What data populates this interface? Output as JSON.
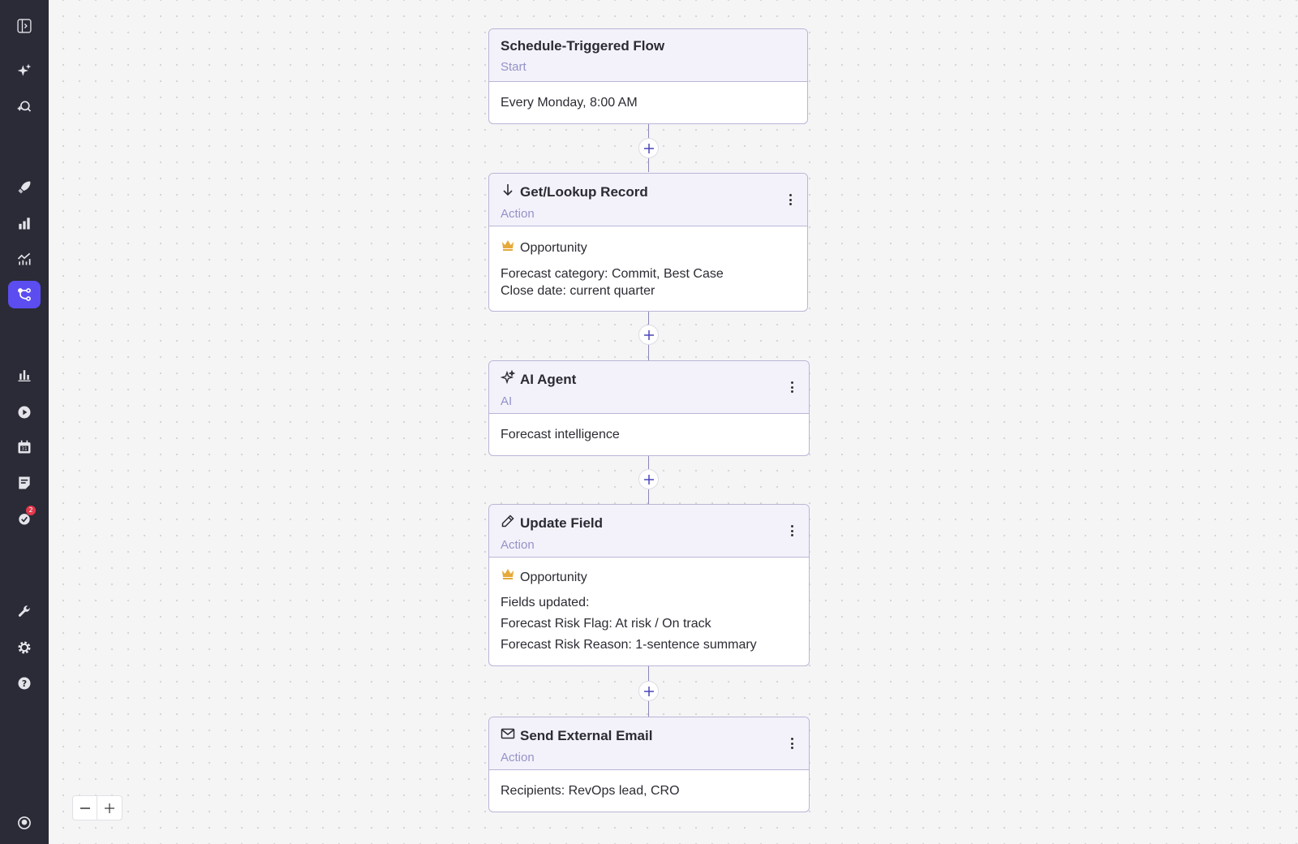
{
  "sidebar": {
    "icons": [
      "sidebar-toggle-icon",
      "sparkle-icon",
      "search-user-icon",
      "rocket-icon",
      "building-chart-icon",
      "line-chart-icon",
      "workflow-icon",
      "bar-chart-icon",
      "play-circle-icon",
      "calendar-icon",
      "note-icon",
      "check-circle-icon",
      "wrench-icon",
      "gear-icon",
      "help-icon",
      "profile-icon"
    ],
    "active": "workflow-icon",
    "notification_count": "2"
  },
  "flow": {
    "start": {
      "title": "Schedule-Triggered Flow",
      "subtitle": "Start",
      "body": "Every Monday, 8:00 AM"
    },
    "lookup": {
      "icon": "arrow-down-icon",
      "title": "Get/Lookup Record",
      "subtitle": "Action",
      "object": "Opportunity",
      "line1": "Forecast category: Commit, Best Case",
      "line2": "Close date: current quarter"
    },
    "agent": {
      "icon": "sparkle-icon",
      "title": "AI Agent",
      "subtitle": "AI",
      "body": "Forecast intelligence"
    },
    "update": {
      "icon": "pencil-icon",
      "title": "Update Field",
      "subtitle": "Action",
      "object": "Opportunity",
      "line1": "Fields updated:",
      "line2": "Forecast Risk Flag: At risk / On track",
      "line3": "Forecast Risk Reason: 1-sentence summary"
    },
    "email": {
      "icon": "mail-icon",
      "title": "Send External Email",
      "subtitle": "Action",
      "body": "Recipients: RevOps lead, CRO"
    }
  },
  "colors": {
    "sidebar_bg": "#2a2b36",
    "accent": "#5b4df0",
    "node_border": "#b9b6d6",
    "subtitle": "#9592c7",
    "badge": "#e2394d",
    "crown": "#e5a93a"
  }
}
